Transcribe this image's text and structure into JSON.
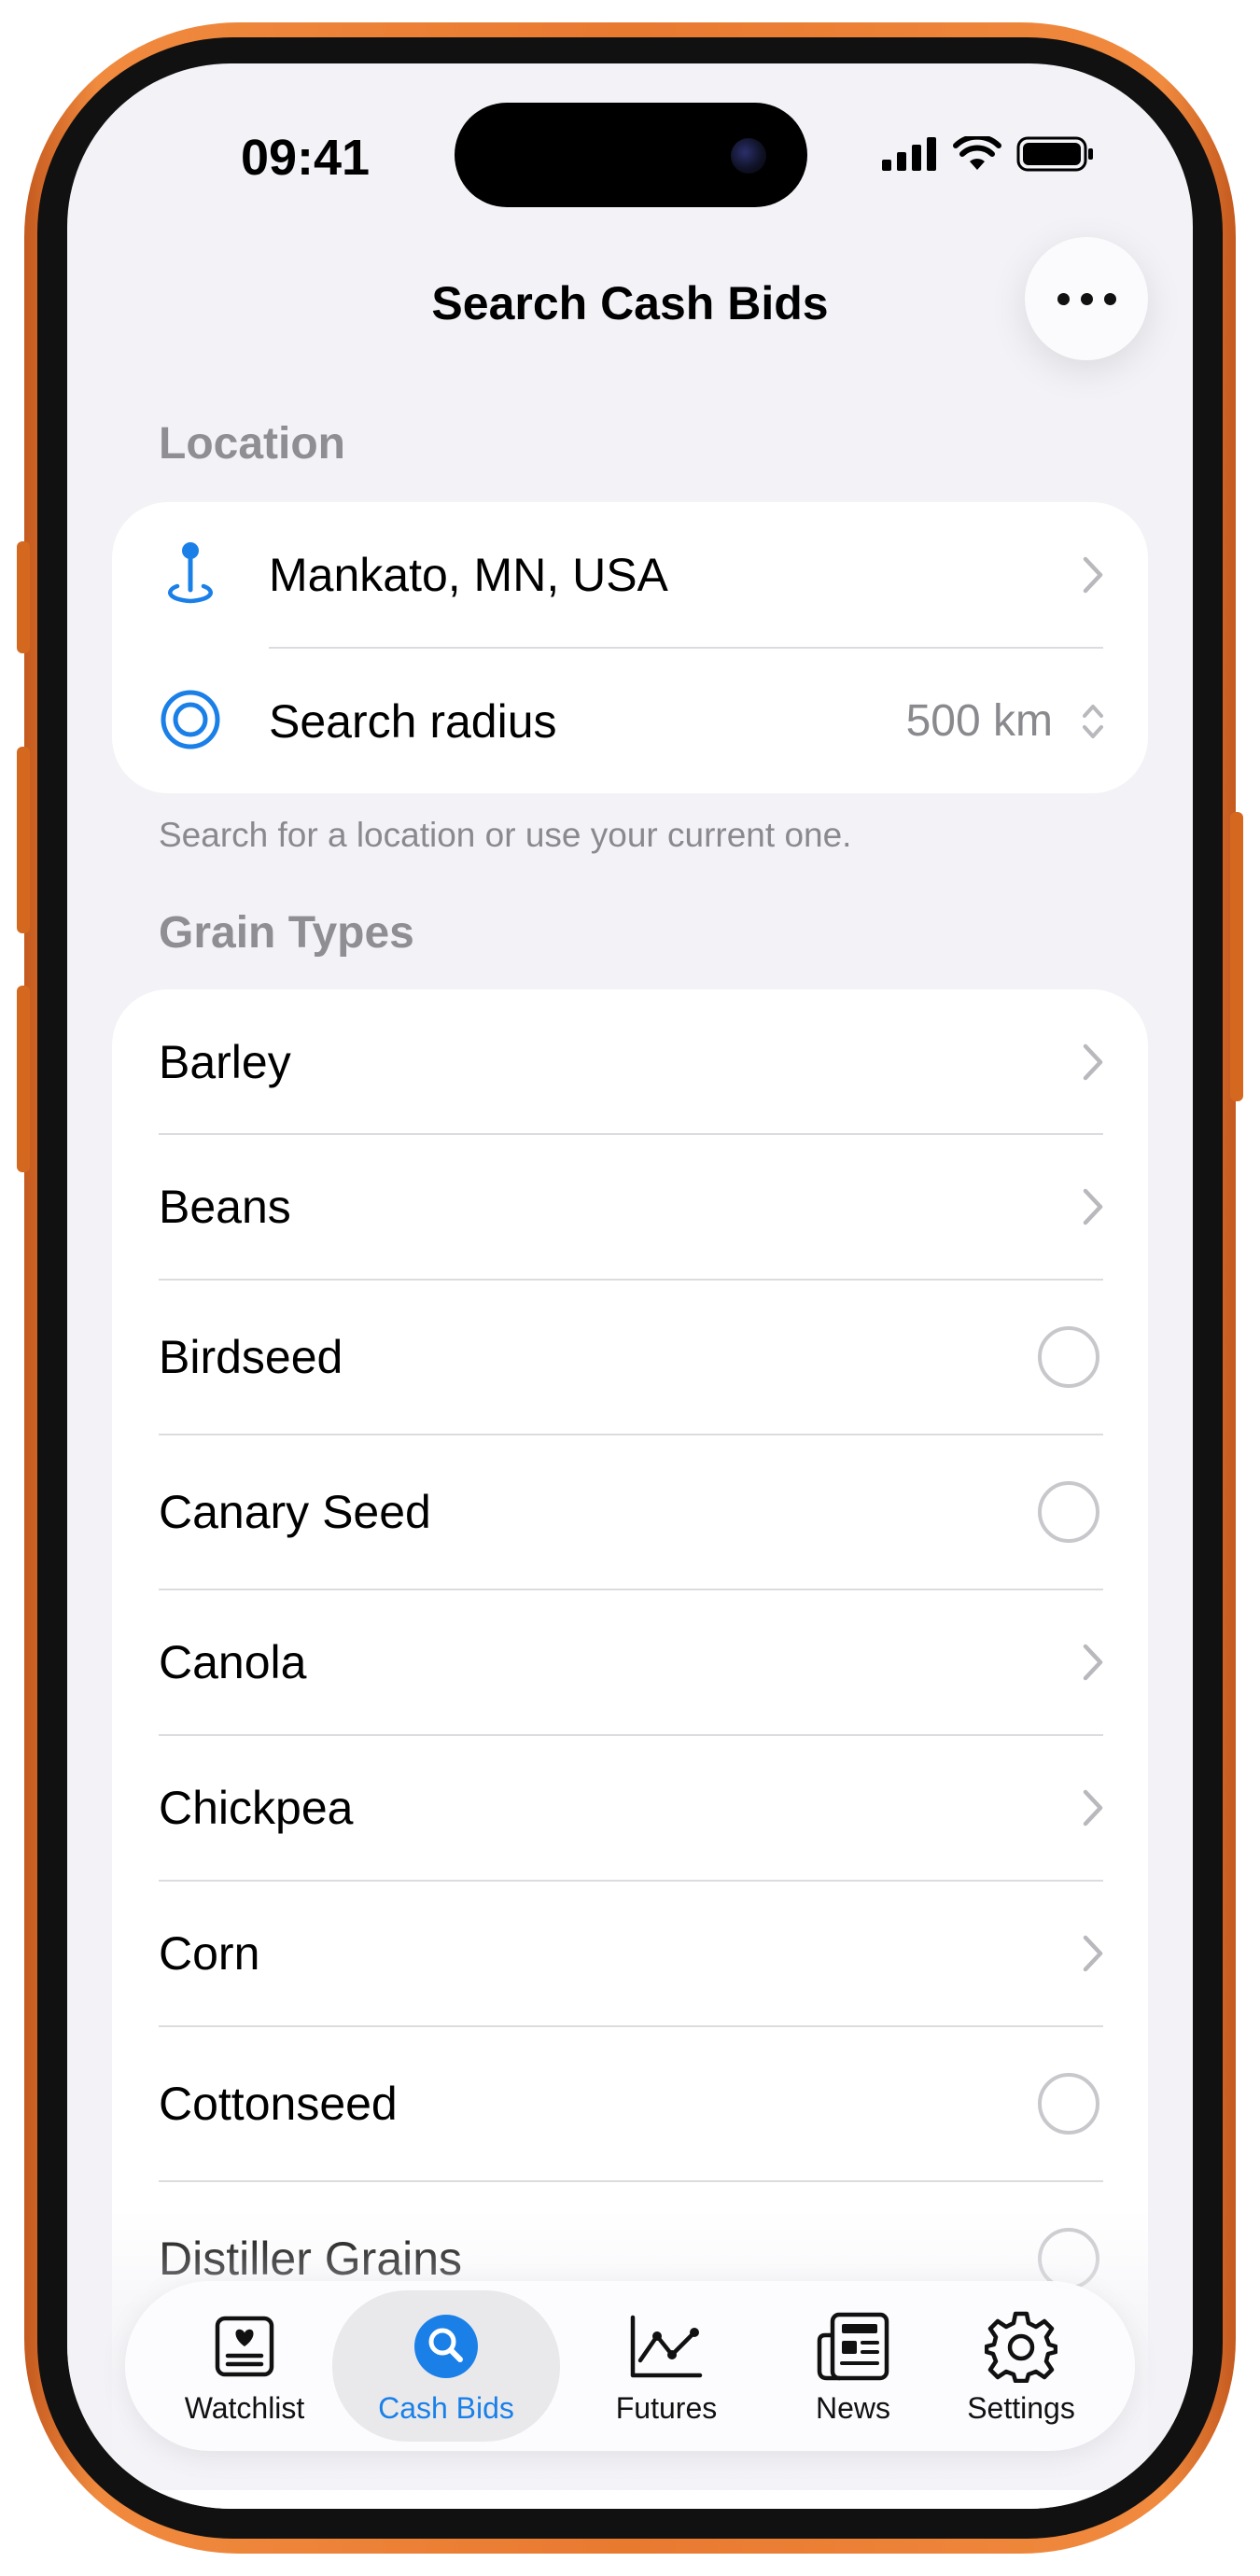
{
  "status_bar": {
    "time": "09:41"
  },
  "header": {
    "title": "Search Cash Bids",
    "more_icon": "ellipsis-icon"
  },
  "location_section": {
    "header": "Location",
    "location_value": "Mankato, MN, USA",
    "radius_label": "Search radius",
    "radius_value": "500 km",
    "footer": "Search for a location or use your current one."
  },
  "grain_section": {
    "header": "Grain Types",
    "items": [
      {
        "label": "Barley",
        "accessory": "chevron"
      },
      {
        "label": "Beans",
        "accessory": "chevron"
      },
      {
        "label": "Birdseed",
        "accessory": "radio"
      },
      {
        "label": "Canary Seed",
        "accessory": "radio"
      },
      {
        "label": "Canola",
        "accessory": "chevron"
      },
      {
        "label": "Chickpea",
        "accessory": "chevron"
      },
      {
        "label": "Corn",
        "accessory": "chevron"
      },
      {
        "label": "Cottonseed",
        "accessory": "radio"
      },
      {
        "label": "Distiller Grains",
        "accessory": "radio"
      }
    ]
  },
  "tab_bar": {
    "active": "Cash Bids",
    "tabs": [
      {
        "label": "Watchlist",
        "icon": "watchlist-icon"
      },
      {
        "label": "Cash Bids",
        "icon": "search-icon"
      },
      {
        "label": "Futures",
        "icon": "chart-icon"
      },
      {
        "label": "News",
        "icon": "newspaper-icon"
      },
      {
        "label": "Settings",
        "icon": "gear-icon"
      }
    ]
  },
  "colors": {
    "accent": "#1a80e8",
    "frame": "#e87a30",
    "background": "#f2f2f7"
  }
}
